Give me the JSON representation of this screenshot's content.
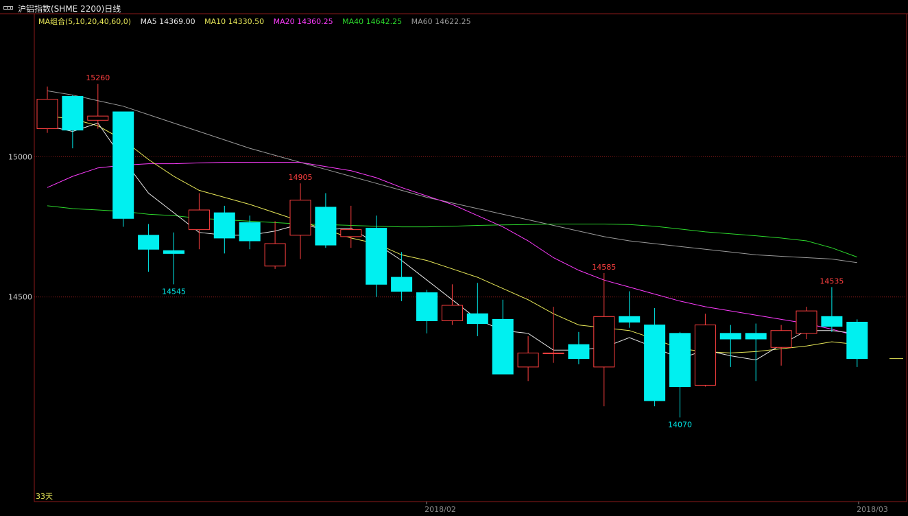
{
  "window": {
    "title": "沪铝指数(SHME 2200)日线"
  },
  "legend": {
    "group": {
      "text": "MA组合(5,10,20,40,60,0)",
      "color": "#e8e858"
    },
    "items": [
      {
        "text": "MA5 14369.00",
        "color": "#e8e8e8"
      },
      {
        "text": "MA10 14330.50",
        "color": "#e8e858"
      },
      {
        "text": "MA20 14360.25",
        "color": "#ff3cff"
      },
      {
        "text": "MA40 14642.25",
        "color": "#2cd82c"
      },
      {
        "text": "MA60 14622.25",
        "color": "#9a9a9a"
      }
    ]
  },
  "footer": {
    "days": "33天"
  },
  "colors": {
    "up": "#ff4040",
    "down": "#00f0f0",
    "frame": "#8b1a1a",
    "grid": "#8b1a1a",
    "axis": "#8a8a8a"
  },
  "chart_data": {
    "type": "candlestick",
    "ylim": [
      13770,
      15510
    ],
    "yticks": [
      15000,
      14500
    ],
    "xticks": [
      "2018/02",
      "2018/03"
    ],
    "candles": [
      {
        "o": 15100,
        "h": 15250,
        "l": 15085,
        "c": 15205
      },
      {
        "o": 15215,
        "h": 15220,
        "l": 15030,
        "c": 15095
      },
      {
        "o": 15130,
        "h": 15260,
        "l": 15100,
        "c": 15145
      },
      {
        "o": 15160,
        "h": 15160,
        "l": 14750,
        "c": 14780
      },
      {
        "o": 14720,
        "h": 14760,
        "l": 14590,
        "c": 14670
      },
      {
        "o": 14665,
        "h": 14730,
        "l": 14545,
        "c": 14655
      },
      {
        "o": 14740,
        "h": 14870,
        "l": 14670,
        "c": 14810
      },
      {
        "o": 14800,
        "h": 14825,
        "l": 14655,
        "c": 14710
      },
      {
        "o": 14765,
        "h": 14790,
        "l": 14670,
        "c": 14700
      },
      {
        "o": 14610,
        "h": 14770,
        "l": 14600,
        "c": 14690
      },
      {
        "o": 14720,
        "h": 14905,
        "l": 14635,
        "c": 14845
      },
      {
        "o": 14820,
        "h": 14870,
        "l": 14675,
        "c": 14685
      },
      {
        "o": 14715,
        "h": 14825,
        "l": 14675,
        "c": 14740
      },
      {
        "o": 14745,
        "h": 14790,
        "l": 14500,
        "c": 14545
      },
      {
        "o": 14570,
        "h": 14660,
        "l": 14485,
        "c": 14520
      },
      {
        "o": 14515,
        "h": 14525,
        "l": 14370,
        "c": 14415
      },
      {
        "o": 14415,
        "h": 14545,
        "l": 14400,
        "c": 14470
      },
      {
        "o": 14440,
        "h": 14550,
        "l": 14360,
        "c": 14405
      },
      {
        "o": 14420,
        "h": 14490,
        "l": 14225,
        "c": 14225
      },
      {
        "o": 14250,
        "h": 14360,
        "l": 14200,
        "c": 14300
      },
      {
        "o": 14300,
        "h": 14465,
        "l": 14265,
        "c": 14300
      },
      {
        "o": 14330,
        "h": 14375,
        "l": 14260,
        "c": 14280
      },
      {
        "o": 14250,
        "h": 14585,
        "l": 14110,
        "c": 14430
      },
      {
        "o": 14430,
        "h": 14520,
        "l": 14390,
        "c": 14410
      },
      {
        "o": 14400,
        "h": 14460,
        "l": 14110,
        "c": 14130
      },
      {
        "o": 14370,
        "h": 14375,
        "l": 14070,
        "c": 14180
      },
      {
        "o": 14185,
        "h": 14440,
        "l": 14180,
        "c": 14400
      },
      {
        "o": 14370,
        "h": 14400,
        "l": 14250,
        "c": 14350
      },
      {
        "o": 14370,
        "h": 14405,
        "l": 14200,
        "c": 14350
      },
      {
        "o": 14320,
        "h": 14400,
        "l": 14255,
        "c": 14380
      },
      {
        "o": 14370,
        "h": 14465,
        "l": 14350,
        "c": 14450
      },
      {
        "o": 14430,
        "h": 14535,
        "l": 14375,
        "c": 14395
      },
      {
        "o": 14410,
        "h": 14420,
        "l": 14250,
        "c": 14280
      }
    ],
    "annotations": [
      {
        "index": 2,
        "price": 15260,
        "text": "15260",
        "pos": "above",
        "color": "#ff4040"
      },
      {
        "index": 5,
        "price": 14545,
        "text": "14545",
        "pos": "below",
        "color": "#00e0e0"
      },
      {
        "index": 10,
        "price": 14905,
        "text": "14905",
        "pos": "above",
        "color": "#ff4040"
      },
      {
        "index": 22,
        "price": 14585,
        "text": "14585",
        "pos": "above",
        "color": "#ff4040"
      },
      {
        "index": 25,
        "price": 14070,
        "text": "14070",
        "pos": "below",
        "color": "#00e0e0"
      },
      {
        "index": 31,
        "price": 14535,
        "text": "14535",
        "pos": "above",
        "color": "#ff4040"
      }
    ],
    "ma": [
      {
        "name": "MA5",
        "color": "#e8e8e8",
        "values": [
          15110,
          15090,
          15120,
          14990,
          14870,
          14800,
          14730,
          14720,
          14720,
          14735,
          14760,
          14740,
          14745,
          14690,
          14630,
          14560,
          14490,
          14420,
          14380,
          14370,
          14310,
          14310,
          14320,
          14355,
          14320,
          14280,
          14310,
          14290,
          14275,
          14330,
          14380,
          14380,
          14369
        ]
      },
      {
        "name": "MA10",
        "color": "#e8e858",
        "values": [
          15145,
          15135,
          15110,
          15060,
          14990,
          14930,
          14880,
          14855,
          14830,
          14800,
          14770,
          14740,
          14710,
          14690,
          14650,
          14630,
          14600,
          14570,
          14530,
          14490,
          14440,
          14400,
          14390,
          14380,
          14350,
          14315,
          14305,
          14300,
          14305,
          14315,
          14325,
          14340,
          14330.5
        ]
      },
      {
        "name": "MA20",
        "color": "#ff3cff",
        "values": [
          14890,
          14930,
          14960,
          14970,
          14975,
          14975,
          14978,
          14980,
          14980,
          14980,
          14980,
          14965,
          14950,
          14925,
          14890,
          14860,
          14830,
          14790,
          14750,
          14700,
          14640,
          14595,
          14560,
          14535,
          14510,
          14485,
          14465,
          14450,
          14435,
          14420,
          14405,
          14385,
          14360.25
        ]
      },
      {
        "name": "MA40",
        "color": "#2cd82c",
        "values": [
          14825,
          14815,
          14810,
          14805,
          14795,
          14790,
          14780,
          14775,
          14770,
          14765,
          14760,
          14758,
          14755,
          14752,
          14750,
          14750,
          14752,
          14755,
          14757,
          14758,
          14760,
          14760,
          14760,
          14758,
          14752,
          14742,
          14732,
          14725,
          14718,
          14710,
          14700,
          14675,
          14642.25
        ]
      },
      {
        "name": "MA60",
        "color": "#9a9a9a",
        "values": [
          15235,
          15220,
          15200,
          15180,
          15150,
          15120,
          15090,
          15060,
          15030,
          15005,
          14980,
          14955,
          14930,
          14905,
          14880,
          14855,
          14835,
          14815,
          14795,
          14775,
          14755,
          14735,
          14715,
          14700,
          14690,
          14680,
          14670,
          14660,
          14650,
          14645,
          14640,
          14635,
          14622.25
        ]
      }
    ],
    "extra_marks": [
      {
        "at": "after-last",
        "price": 14280,
        "color": "#e8e858"
      }
    ]
  }
}
